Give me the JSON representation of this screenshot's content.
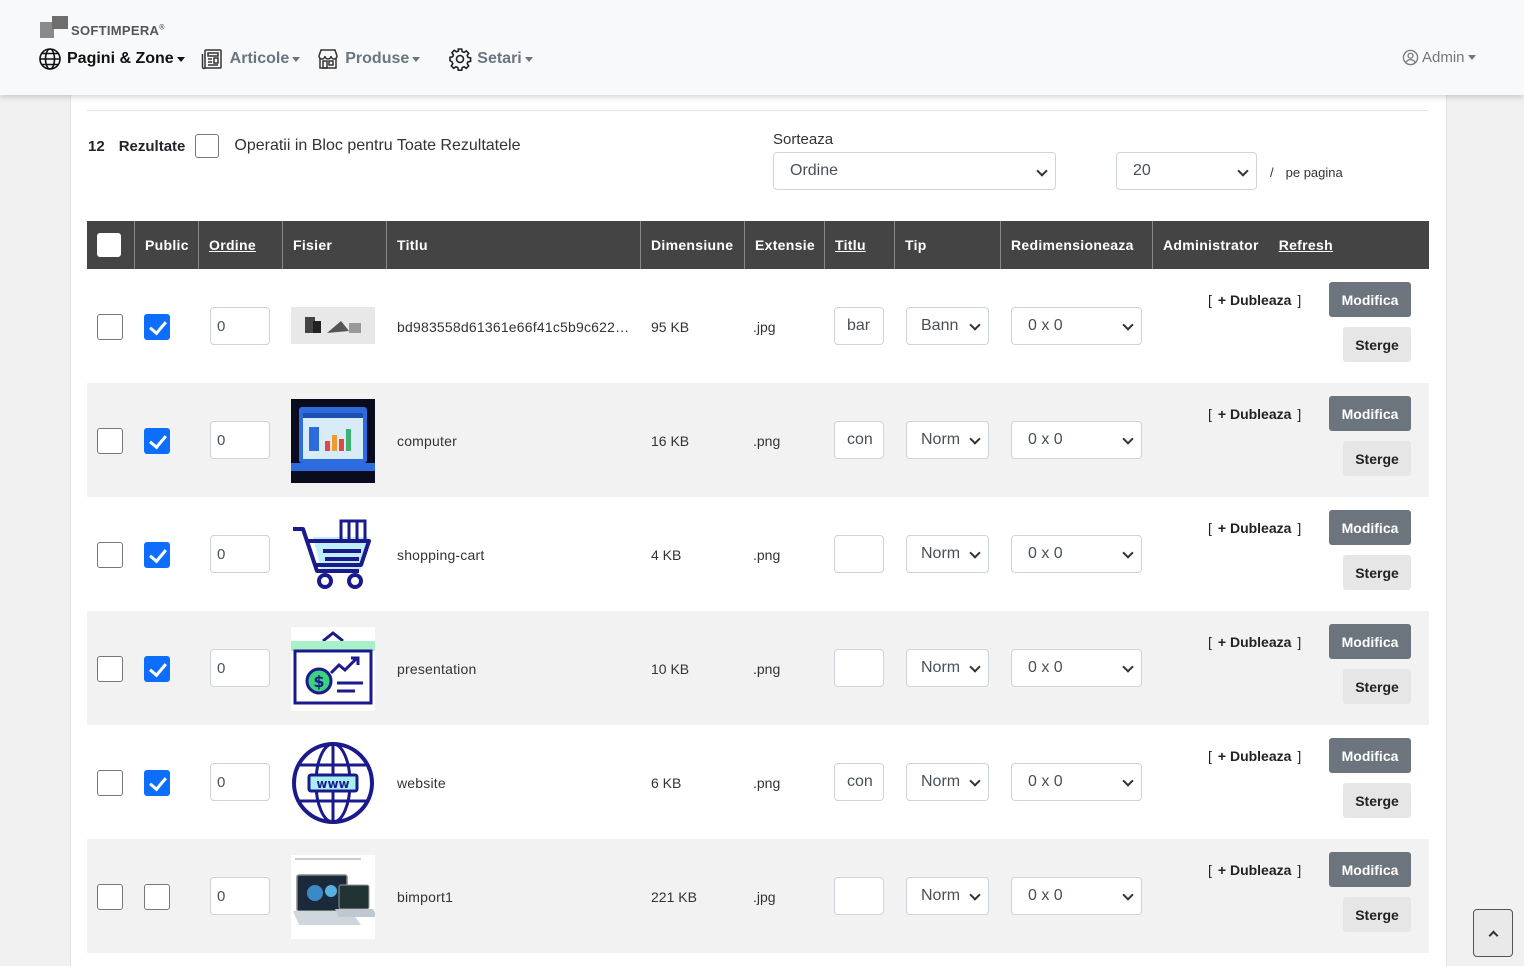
{
  "brand": {
    "name": "SOFTIMPERA",
    "mark": "®"
  },
  "nav": {
    "items": [
      {
        "label": "Pagini & Zone",
        "icon": "globe-icon"
      },
      {
        "label": "Articole",
        "icon": "newspaper-icon"
      },
      {
        "label": "Produse",
        "icon": "shop-icon"
      },
      {
        "label": "Setari",
        "icon": "gear-icon"
      }
    ],
    "user": {
      "label": "Admin",
      "icon": "user-circle-icon"
    }
  },
  "toolbar": {
    "results_count": "12",
    "results_label": "Rezultate",
    "bulk_label": "Operatii in Bloc pentru Toate Rezultatele",
    "sort_label": "Sorteaza",
    "sort_value": "Ordine",
    "per_page_value": "20",
    "per_page_sep": "/",
    "per_page_label": "pe pagina"
  },
  "table": {
    "headers": {
      "public": "Public",
      "ordine": "Ordine",
      "fisier": "Fisier",
      "titlu": "Titlu",
      "dimensiune": "Dimensiune",
      "extensie": "Extensie",
      "titlu2": "Titlu",
      "tip": "Tip",
      "redimensioneaza": "Redimensioneaza",
      "administrator": "Administrator",
      "refresh": "Refresh"
    },
    "actions": {
      "bracket_open": "[",
      "duplicate": "+ Dubleaza",
      "bracket_close": "]",
      "modify": "Modifica",
      "delete": "Sterge"
    },
    "rows": [
      {
        "public": true,
        "order": "0",
        "thumb": "photo",
        "title": "bd983558d61361e66f41c5b9c622ea...",
        "size": "95 KB",
        "ext": ".jpg",
        "title_field": "bar",
        "type": "Bann",
        "resize": "0 x 0"
      },
      {
        "public": true,
        "order": "0",
        "thumb": "computer-icon",
        "title": "computer",
        "size": "16 KB",
        "ext": ".png",
        "title_field": "con",
        "type": "Norm",
        "resize": "0 x 0"
      },
      {
        "public": true,
        "order": "0",
        "thumb": "shopping-cart-icon",
        "title": "shopping-cart",
        "size": "4 KB",
        "ext": ".png",
        "title_field": "",
        "type": "Norm",
        "resize": "0 x 0"
      },
      {
        "public": true,
        "order": "0",
        "thumb": "presentation-icon",
        "title": "presentation",
        "size": "10 KB",
        "ext": ".png",
        "title_field": "",
        "type": "Norm",
        "resize": "0 x 0"
      },
      {
        "public": true,
        "order": "0",
        "thumb": "website-icon",
        "title": "website",
        "size": "6 KB",
        "ext": ".png",
        "title_field": "con",
        "type": "Norm",
        "resize": "0 x 0"
      },
      {
        "public": false,
        "order": "0",
        "thumb": "laptop-photo",
        "title": "bimport1",
        "size": "221 KB",
        "ext": ".jpg",
        "title_field": "",
        "type": "Norm",
        "resize": "0 x 0"
      }
    ]
  }
}
